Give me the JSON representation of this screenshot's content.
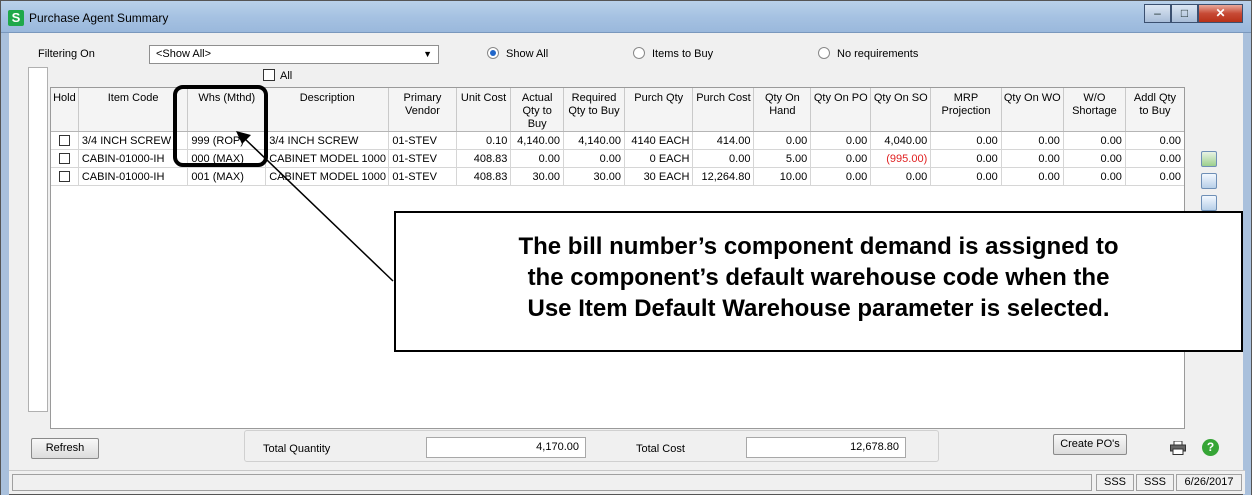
{
  "window": {
    "title": "Purchase Agent Summary",
    "app_letter": "S"
  },
  "filter": {
    "label": "Filtering On",
    "value": "<Show All>",
    "options": [
      {
        "label": "Show All",
        "selected": true
      },
      {
        "label": "Items to Buy",
        "selected": false
      },
      {
        "label": "No requirements",
        "selected": false
      }
    ],
    "all_label": "All"
  },
  "grid": {
    "columns": [
      "Hold",
      "Item Code",
      "Whs (Mthd)",
      "Description",
      "Primary Vendor",
      "Unit Cost",
      "Actual Qty to Buy",
      "Required Qty to Buy",
      "Purch Qty",
      "Purch Cost",
      "Qty On Hand",
      "Qty On PO",
      "Qty On SO",
      "MRP Projection",
      "Qty On WO",
      "W/O Shortage",
      "Addl Qty to Buy"
    ],
    "rows": [
      [
        "",
        "3/4 INCH SCREW",
        "999 (ROP)",
        "3/4 INCH SCREW",
        "01-STEV",
        "0.10",
        "4,140.00",
        "4,140.00",
        "4140 EACH",
        "414.00",
        "0.00",
        "0.00",
        "4,040.00",
        "0.00",
        "0.00",
        "0.00",
        "0.00"
      ],
      [
        "",
        "CABIN-01000-IH",
        "000 (MAX)",
        "CABINET MODEL 1000",
        "01-STEV",
        "408.83",
        "0.00",
        "0.00",
        "0 EACH",
        "0.00",
        "5.00",
        "0.00",
        "(995.00)",
        "0.00",
        "0.00",
        "0.00",
        "0.00"
      ],
      [
        "",
        "CABIN-01000-IH",
        "001 (MAX)",
        "CABINET MODEL 1000",
        "01-STEV",
        "408.83",
        "30.00",
        "30.00",
        "30 EACH",
        "12,264.80",
        "10.00",
        "0.00",
        "0.00",
        "0.00",
        "0.00",
        "0.00",
        "0.00"
      ]
    ]
  },
  "callout": {
    "lines": [
      "The bill number’s component demand is assigned to",
      "the component’s default warehouse code when the",
      "Use Item Default Warehouse parameter is selected."
    ]
  },
  "footer": {
    "refresh_label": "Refresh",
    "total_quantity_label": "Total Quantity",
    "total_quantity_value": "4,170.00",
    "total_cost_label": "Total Cost",
    "total_cost_value": "12,678.80",
    "create_po_label": "Create PO's"
  },
  "status": {
    "company1": "SSS",
    "company2": "SSS",
    "date": "6/26/2017"
  },
  "colors": {
    "negative": "#e02020",
    "help_icon": "#36a536",
    "app_icon": "#1fa84a"
  },
  "icons": [
    "new-document-icon",
    "green-document-icon",
    "green-document-icon-2",
    "binoculars-icon",
    "printer-icon",
    "help-icon"
  ]
}
